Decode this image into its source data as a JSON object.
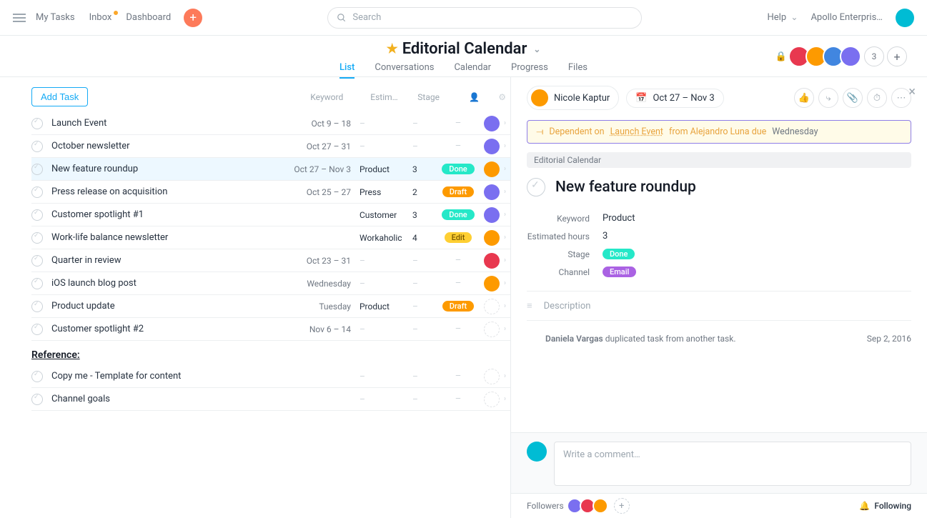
{
  "nav": {
    "my_tasks": "My Tasks",
    "inbox": "Inbox",
    "dashboard": "Dashboard",
    "search_placeholder": "Search",
    "help": "Help",
    "org": "Apollo Enterpris…"
  },
  "project": {
    "title": "Editorial Calendar",
    "tabs": {
      "list": "List",
      "conversations": "Conversations",
      "calendar": "Calendar",
      "progress": "Progress",
      "files": "Files"
    },
    "active_tab": "List",
    "member_overflow": "3"
  },
  "list": {
    "add_task": "Add Task",
    "cols": {
      "keyword": "Keyword",
      "estim": "Estim…",
      "stage": "Stage"
    },
    "section": "Reference:",
    "tasks": [
      {
        "name": "Launch Event",
        "date": "Oct 9 – 18",
        "keyword": "",
        "est": "",
        "stage": "",
        "av": "c-purple"
      },
      {
        "name": "October newsletter",
        "date": "Oct 27 – 31",
        "keyword": "",
        "est": "",
        "stage": "",
        "av": "c-purple"
      },
      {
        "name": "New feature roundup",
        "date": "Oct 27 – Nov 3",
        "keyword": "Product",
        "est": "3",
        "stage": "Done",
        "av": "c-orange",
        "selected": true
      },
      {
        "name": "Press release on acquisition",
        "date": "Oct 25 – 27",
        "keyword": "Press",
        "est": "2",
        "stage": "Draft",
        "av": "c-purple"
      },
      {
        "name": "Customer spotlight #1",
        "date": "",
        "keyword": "Customer",
        "est": "3",
        "stage": "Done",
        "av": "c-purple"
      },
      {
        "name": "Work-life balance newsletter",
        "date": "",
        "keyword": "Workaholic",
        "est": "4",
        "stage": "Edit",
        "av": "c-orange"
      },
      {
        "name": "Quarter in review",
        "date": "Oct 23 – 31",
        "keyword": "",
        "est": "",
        "stage": "",
        "av": "c-red"
      },
      {
        "name": "iOS launch blog post",
        "date": "Wednesday",
        "keyword": "",
        "est": "",
        "stage": "",
        "av": "c-orange"
      },
      {
        "name": "Product update",
        "date": "Tuesday",
        "keyword": "Product",
        "est": "",
        "stage": "Draft",
        "av": ""
      },
      {
        "name": "Customer spotlight #2",
        "date": "Nov 6 – 14",
        "keyword": "",
        "est": "",
        "stage": "",
        "av": ""
      }
    ],
    "ref_tasks": [
      {
        "name": "Copy me - Template for content"
      },
      {
        "name": "Channel goals"
      }
    ]
  },
  "detail": {
    "assignee": "Nicole Kaptur",
    "date": "Oct 27 – Nov 3",
    "dep_prefix": "Dependent on",
    "dep_event": "Launch Event",
    "dep_from": "from Alejandro Luna due",
    "dep_due": "Wednesday",
    "project_chip": "Editorial Calendar",
    "title": "New feature roundup",
    "fields": {
      "keyword_l": "Keyword",
      "keyword_v": "Product",
      "est_l": "Estimated hours",
      "est_v": "3",
      "stage_l": "Stage",
      "stage_v": "Done",
      "channel_l": "Channel",
      "channel_v": "Email"
    },
    "description_label": "Description",
    "activity_who": "Daniela Vargas",
    "activity_text": "duplicated task from another task.",
    "activity_when": "Sep 2, 2016",
    "comment_placeholder": "Write a comment…",
    "followers_label": "Followers",
    "following_label": "Following"
  }
}
